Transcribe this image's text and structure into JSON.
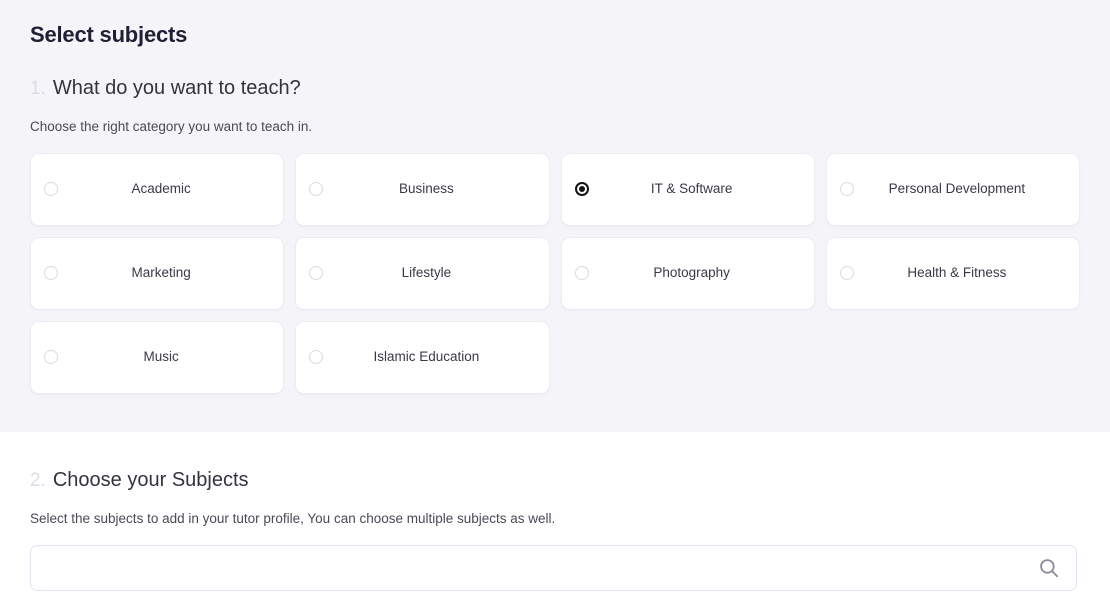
{
  "page": {
    "title": "Select subjects"
  },
  "step1": {
    "number": "1.",
    "heading": "What do you want to teach?",
    "subtitle": "Choose the right category you want to teach in.",
    "categories": [
      {
        "label": "Academic",
        "selected": false
      },
      {
        "label": "Business",
        "selected": false
      },
      {
        "label": "IT & Software",
        "selected": true
      },
      {
        "label": "Personal Development",
        "selected": false
      },
      {
        "label": "Marketing",
        "selected": false
      },
      {
        "label": "Lifestyle",
        "selected": false
      },
      {
        "label": "Photography",
        "selected": false
      },
      {
        "label": "Health & Fitness",
        "selected": false
      },
      {
        "label": "Music",
        "selected": false
      },
      {
        "label": "Islamic Education",
        "selected": false
      }
    ]
  },
  "step2": {
    "number": "2.",
    "heading": "Choose your Subjects",
    "subtitle": "Select the subjects to add in your tutor profile, You can choose multiple subjects as well.",
    "search": {
      "value": "",
      "placeholder": "",
      "icon": "search-icon"
    }
  },
  "colors": {
    "panel_background": "#f4f4f9",
    "card_background": "#ffffff",
    "card_border": "#ececf3",
    "title_text": "#1f1f35",
    "step_number": "#dcdce4",
    "body_text": "#3a3a47",
    "radio_selected": "#141414",
    "radio_unselected_border": "#dadae3",
    "input_border": "#e3e3f0",
    "search_icon": "#8b8b99"
  }
}
